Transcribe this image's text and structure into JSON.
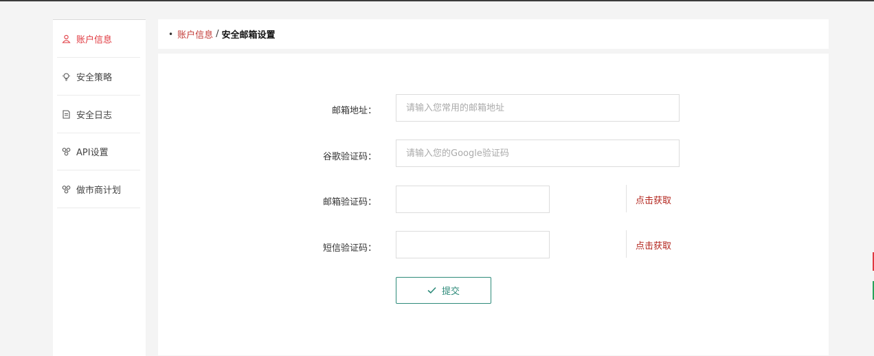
{
  "sidebar": {
    "items": [
      {
        "label": "账户信息",
        "icon": "user-icon",
        "active": true
      },
      {
        "label": "安全策略",
        "icon": "lightbulb-icon",
        "active": false
      },
      {
        "label": "安全日志",
        "icon": "document-icon",
        "active": false
      },
      {
        "label": "API设置",
        "icon": "nodes-icon",
        "active": false
      },
      {
        "label": "做市商计划",
        "icon": "nodes-icon",
        "active": false
      }
    ]
  },
  "breadcrumb": {
    "bullet": "•",
    "parent": "账户信息",
    "separator": "/",
    "current": "安全邮箱设置"
  },
  "form": {
    "email": {
      "label": "邮箱地址：",
      "placeholder": "请输入您常用的邮箱地址",
      "value": ""
    },
    "google_code": {
      "label": "谷歌验证码：",
      "placeholder": "请输入您的Google验证码",
      "value": ""
    },
    "email_code": {
      "label": "邮箱验证码：",
      "value": "",
      "get_code": "点击获取"
    },
    "sms_code": {
      "label": "短信验证码：",
      "value": "",
      "get_code": "点击获取"
    },
    "submit_label": "提交"
  },
  "colors": {
    "accent_red": "#e0383f",
    "link_red": "#b3261e",
    "submit_green": "#2c8a79",
    "background": "#f4f4f4"
  }
}
